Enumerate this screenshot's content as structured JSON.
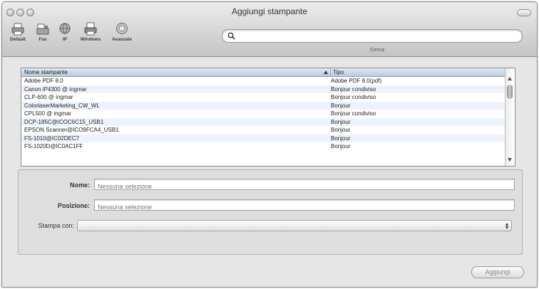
{
  "window": {
    "title": "Aggiungi stampante"
  },
  "toolbar": {
    "items": [
      {
        "label": "Default",
        "icon": "default-printer-icon"
      },
      {
        "label": "Fax",
        "icon": "fax-icon"
      },
      {
        "label": "IP",
        "icon": "ip-globe-icon"
      },
      {
        "label": "Windows",
        "icon": "windows-printer-icon"
      },
      {
        "label": "Avanzate",
        "icon": "advanced-gear-icon"
      }
    ]
  },
  "search": {
    "placeholder": "",
    "label": "Cerca"
  },
  "table": {
    "columns": [
      "Nome stampante",
      "Tipo"
    ],
    "rows": [
      [
        "Adobe PDF 8.0",
        "Adobe PDF 8.0(pdf)"
      ],
      [
        "Canon iP4300 @ ingmar",
        "Bonjour condiviso"
      ],
      [
        "CLP-600 @ ingmar",
        "Bonjour condiviso"
      ],
      [
        "ColorlaserMarketing_CW_WL",
        "Bonjour"
      ],
      [
        "CPL500 @ ingmar",
        "Bonjour condiviso"
      ],
      [
        "DCP-185C@ICOC6C15_USB1",
        "Bonjour"
      ],
      [
        "EPSON Scanner@ICO9FCA4_USB1",
        "Bonjour"
      ],
      [
        "FS-1010@IC02DEC7",
        "Bonjour"
      ],
      [
        "FS-1020D@IC0AC1FF",
        "Bonjour"
      ]
    ]
  },
  "form": {
    "name_label": "Nome:",
    "name_placeholder": "Nessuna selezione",
    "location_label": "Posizione:",
    "location_placeholder": "Nessuna selezione",
    "print_with_label": "Stampa con:",
    "print_with_value": ""
  },
  "buttons": {
    "add": "Aggiungi"
  },
  "colors": {
    "header_blue": "#b9c8dd",
    "row_stripe": "#edf3fe",
    "chrome": "#c4c4c4"
  }
}
